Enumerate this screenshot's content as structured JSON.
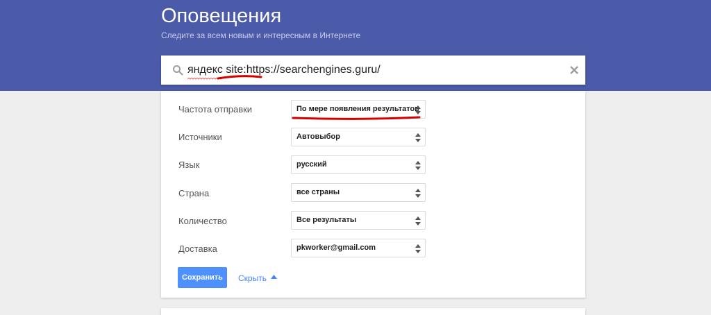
{
  "header": {
    "title": "Оповещения",
    "subtitle": "Следите за всем новым и интересным в Интернете"
  },
  "search": {
    "value": "яндекс site:https://searchengines.guru/"
  },
  "form": {
    "rows": [
      {
        "label": "Частота отправки",
        "value": "По мере появления результатов"
      },
      {
        "label": "Источники",
        "value": "Автовыбор"
      },
      {
        "label": "Язык",
        "value": "русский"
      },
      {
        "label": "Страна",
        "value": "все страны"
      },
      {
        "label": "Количество",
        "value": "Все результаты"
      },
      {
        "label": "Доставка",
        "value": "pkworker@gmail.com"
      }
    ],
    "save_label": "Сохранить",
    "hide_label": "Скрыть"
  },
  "colors": {
    "header_bg": "#4b5aa9",
    "button_bg": "#4d90fe",
    "link": "#4285f4",
    "annotation": "#d60000"
  },
  "icons": {
    "search": "search-icon",
    "clear": "close-icon",
    "select": "sort-arrows-icon",
    "hide": "caret-up-icon"
  }
}
